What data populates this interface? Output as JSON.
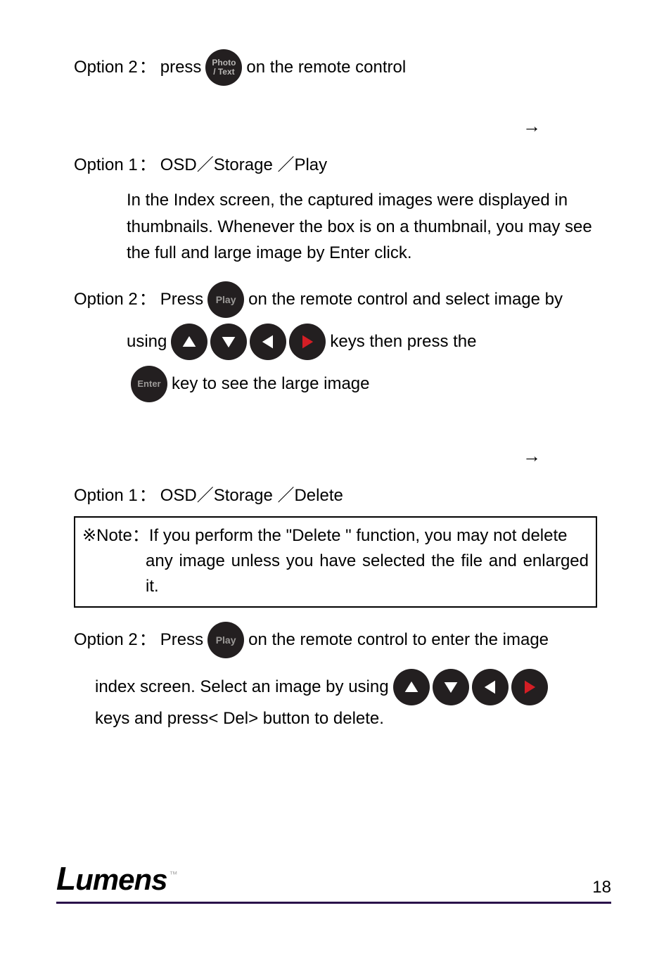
{
  "section_top": {
    "option2_prefix": "Option 2",
    "colon": "：",
    "press": "press",
    "icon_label": "Photo\n/ Text",
    "after": "on the remote control"
  },
  "heading1": {
    "arrow": "→"
  },
  "section_play": {
    "option1_prefix": "Option 1",
    "colon": "：",
    "path": "OSD／Storage ／Play",
    "paragraph": "In the Index screen, the captured images were displayed in thumbnails. Whenever the box is on a thumbnail, you may see the full and large image by Enter click.",
    "option2_prefix": "Option 2",
    "press2": "Press",
    "play_icon": "Play",
    "after_play": " on the remote control and select image by",
    "using": "using ",
    "keys_then": " keys then press the",
    "enter_icon": "Enter",
    "key_tosee": " key to see the large image"
  },
  "heading2": {
    "arrow": "→"
  },
  "section_delete": {
    "option1_prefix": "Option 1",
    "colon": "：",
    "path": "OSD／Storage ／Delete",
    "note_prefix": "※Note",
    "note_colon": "：",
    "note_text_line1": "If you perform the \"Delete \" function, you may not delete",
    "note_text_line2": "any image unless you have selected the file and enlarged it.",
    "option2_prefix": "Option 2",
    "press2": "Press",
    "play_icon": "Play",
    "after_play": " on the remote control to enter the image",
    "line2a": "index screen. Select an image by using ",
    "line2b": "keys and press< Del> button to delete."
  },
  "footer": {
    "logo_l": "L",
    "logo_rest": "umens",
    "tm": "™",
    "page": "18"
  },
  "colors": {
    "arrow_white": "#ffffff",
    "arrow_red": "#d41e25"
  }
}
